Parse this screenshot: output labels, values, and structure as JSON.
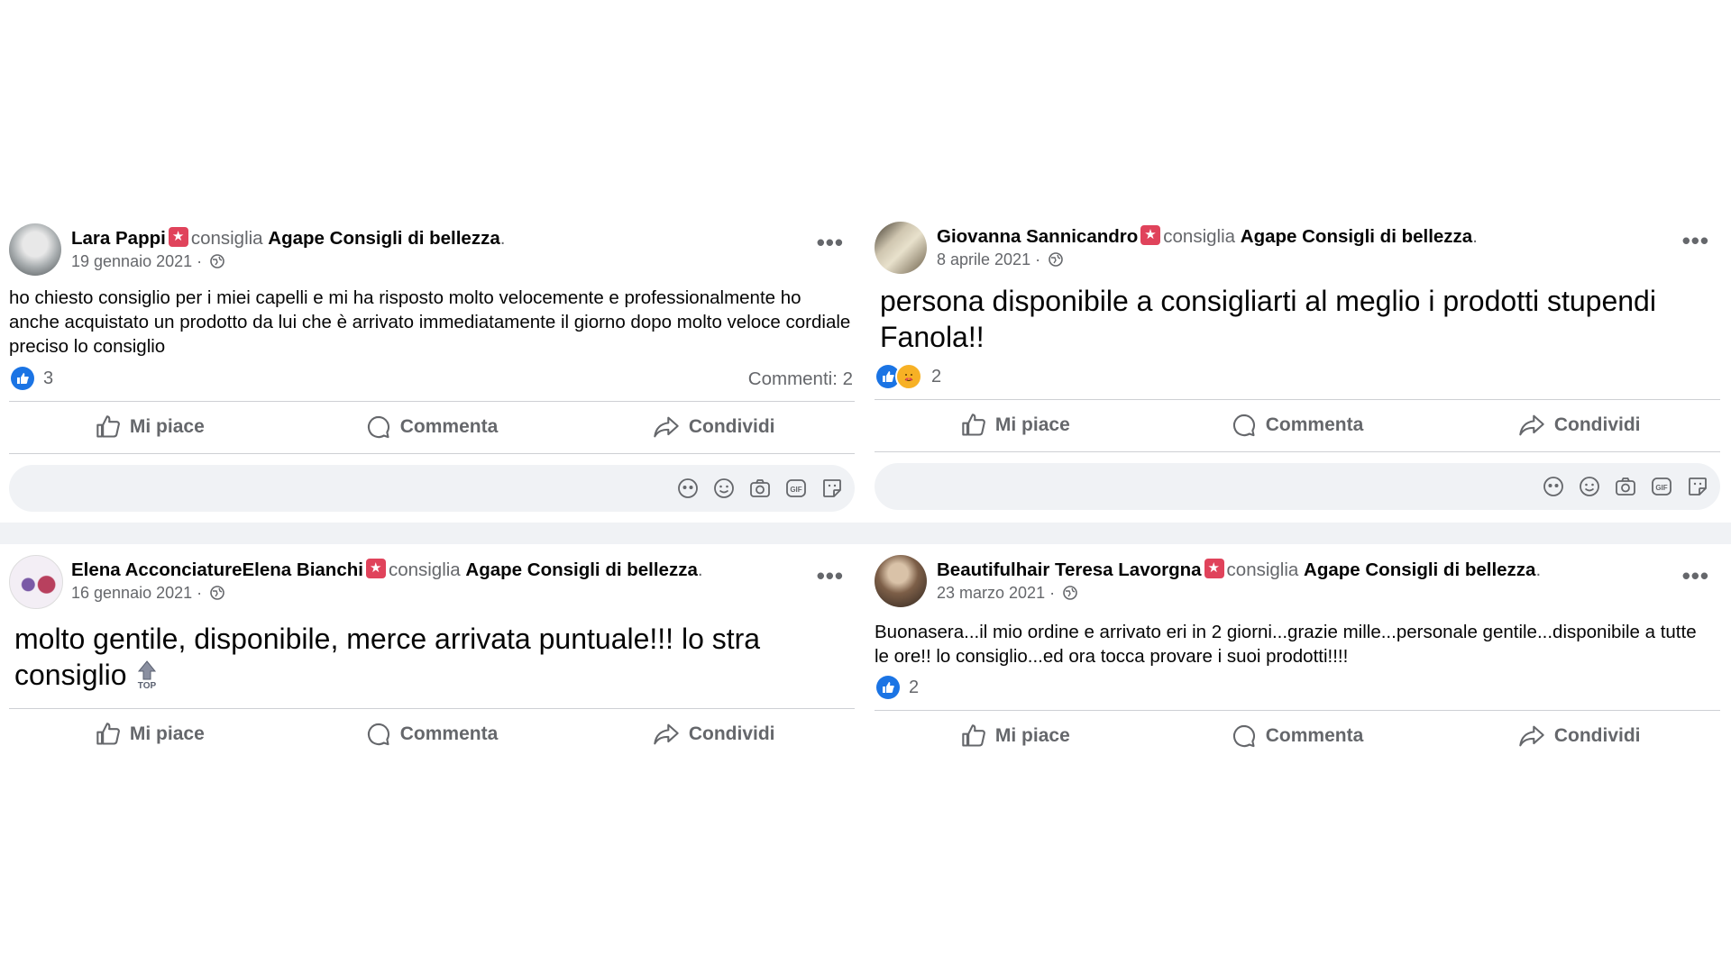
{
  "colors": {
    "brand_star": "#e0435b",
    "like_blue": "#1b74e4",
    "muted": "#65676b"
  },
  "common": {
    "recommends": "consiglia",
    "page_name": "Agape Consigli di bellezza",
    "like_label": "Mi piace",
    "comment_label": "Commenta",
    "share_label": "Condividi"
  },
  "posts": [
    {
      "author": "Lara Pappi",
      "date": "19 gennaio 2021",
      "text": "ho chiesto consiglio per i miei capelli e mi ha risposto molto velocemente e professionalmente ho anche acquistato un prodotto da lui che è arrivato immediatamente il giorno dopo molto veloce cordiale preciso lo consiglio",
      "reactions": "3",
      "comments": "Commenti: 2",
      "reaction_icons": [
        "like-icon"
      ]
    },
    {
      "author": "Giovanna Sannicandro",
      "date": "8 aprile 2021",
      "text": "persona disponibile a consigliarti al meglio i prodotti stupendi Fanola!!",
      "reactions": "2",
      "reaction_icons": [
        "like-icon",
        "care-icon"
      ]
    },
    {
      "author": "Elena AcconciatureElena Bianchi",
      "date": "16 gennaio 2021",
      "text": "molto gentile, disponibile, merce arrivata puntuale!!! lo stra consiglio",
      "emoji": "top-emoji"
    },
    {
      "author": "Beautifulhair Teresa Lavorgna",
      "date": "23 marzo 2021",
      "text": "Buonasera...il mio ordine e arrivato eri in 2 giorni...grazie mille...personale gentile...disponibile a tutte le ore!! lo consiglio...ed ora tocca provare i suoi prodotti!!!!",
      "reactions": "2",
      "reaction_icons": [
        "like-icon"
      ]
    }
  ]
}
